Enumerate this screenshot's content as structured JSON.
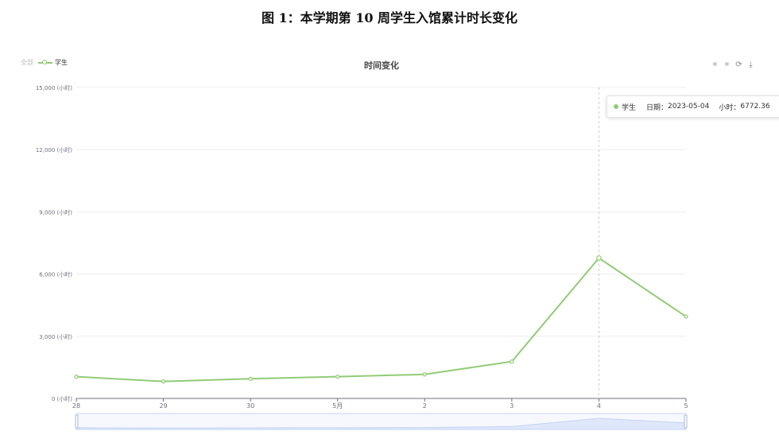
{
  "figure_title": "图 1：本学期第 10 周学生入馆累计时长变化",
  "legend": {
    "muted_label": "全部",
    "series_label": "学生"
  },
  "toolbox": {
    "zoom_icon": "zoom-icon",
    "zoom_reset_icon": "zoom-reset-icon",
    "restore_icon": "restore-icon",
    "download_icon": "download-icon"
  },
  "tooltip": {
    "series": "学生",
    "date_label": "日期：",
    "date_value": "2023-05-04",
    "hours_label": "小时：",
    "hours_value": "6772.36"
  },
  "colors": {
    "series": "#91cc75",
    "grid": "#eeeeee",
    "axis": "#6e7079",
    "slider_fill": "#dfe8fb",
    "slider_border": "#c5d3f1"
  },
  "chart_data": {
    "type": "line",
    "title": "时间变化",
    "categories": [
      "28",
      "29",
      "30",
      "5月",
      "2",
      "3",
      "4",
      "5"
    ],
    "series": [
      {
        "name": "学生",
        "values": [
          1050,
          820,
          950,
          1050,
          1160,
          1780,
          6772.36,
          3950
        ]
      }
    ],
    "y_ticks": [
      "0 (小时)",
      "3,000 (小时)",
      "6,000 (小时)",
      "9,000 (小时)",
      "12,000 (小时)",
      "15,000 (小时)"
    ],
    "ylim": [
      0,
      15000
    ],
    "grid": true,
    "legend_position": "top-left",
    "highlight_index": 6
  }
}
